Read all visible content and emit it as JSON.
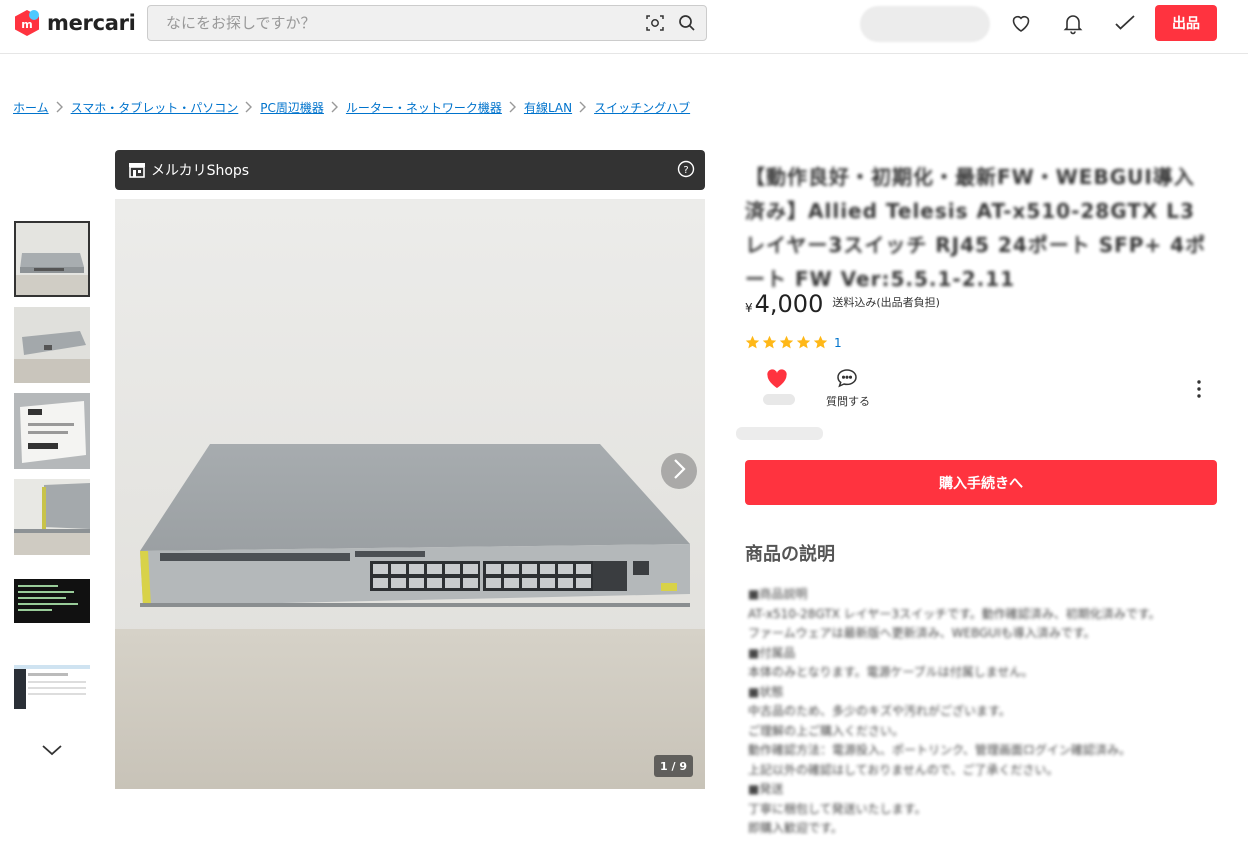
{
  "header": {
    "logo_text": "mercari",
    "search_placeholder": "なにをお探しですか？",
    "sell_label": "出品",
    "icons": [
      "scan-icon",
      "search-icon",
      "heart-icon",
      "bell-icon",
      "check-icon"
    ]
  },
  "breadcrumb": [
    "ホーム",
    "スマホ・タブレット・パソコン",
    "PC周辺機器",
    "ルーター・ネットワーク機器",
    "有線LAN",
    "スイッチングハブ"
  ],
  "shops": {
    "label": "メルカリShops"
  },
  "gallery": {
    "counter": "1 / 9",
    "thumbnail_count": 6
  },
  "product": {
    "title": "【動作良好・初期化・最新FW・WEBGUI導入済み】Allied Telesis AT-x510-28GTX L3レイヤー3スイッチ RJ45 24ポート SFP+ 4ポート FW Ver:5.5.1-2.11",
    "price_symbol": "¥",
    "price": "4,000",
    "shipping": "送料込み(出品者負担)",
    "rating_stars": 5,
    "rating_count": "1",
    "question_label": "質問する",
    "buy_label": "購入手続きへ",
    "description_heading": "商品の説明",
    "description": "■商品説明\nAT-x510-28GTX レイヤー3スイッチです。動作確認済み、初期化済みです。\nファームウェアは最新版へ更新済み、WEBGUIも導入済みです。\n■付属品\n本体のみとなります。電源ケーブルは付属しません。\n■状態\n中古品のため、多少のキズや汚れがございます。\nご理解の上ご購入ください。\n動作確認方法：電源投入、ポートリンク、管理画面ログイン確認済み。\n上記以外の確認はしておりませんので、ご了承ください。\n■発送\n丁寧に梱包して発送いたします。\n即購入歓迎です。"
  },
  "colors": {
    "brand_red": "#ff333f",
    "link_blue": "#0073cc",
    "star_yellow": "#ffb818"
  }
}
